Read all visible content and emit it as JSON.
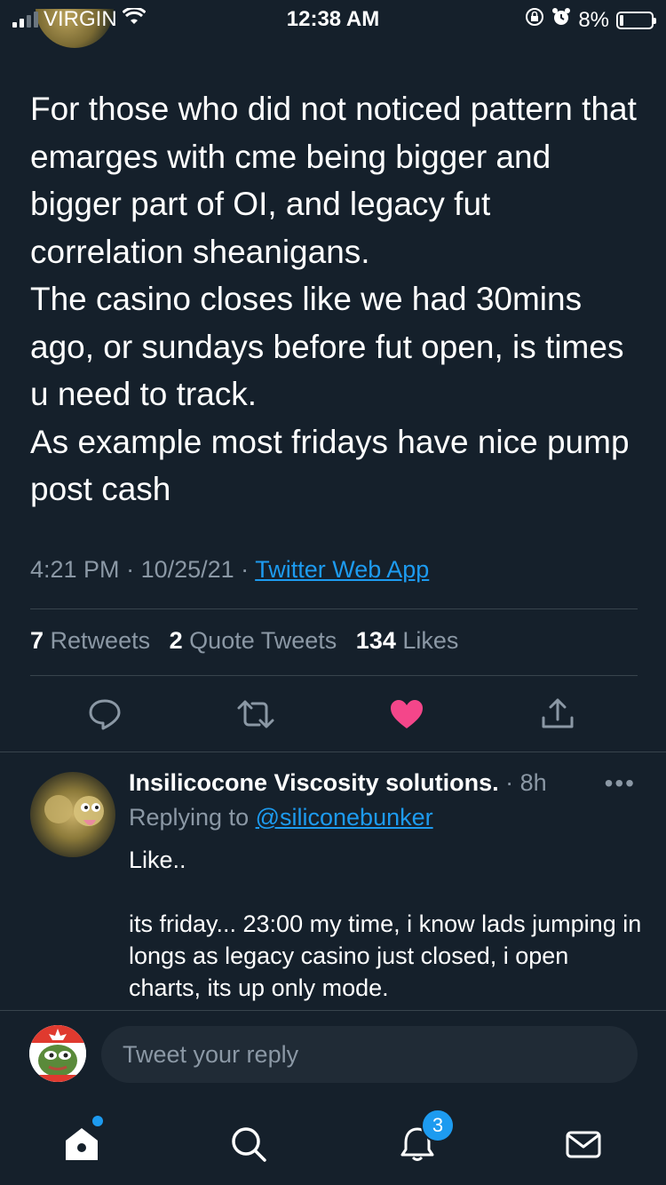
{
  "status_bar": {
    "carrier": "VIRGIN",
    "time": "12:38 AM",
    "battery": "8%"
  },
  "tweet": {
    "text": "For those who did not noticed pattern that emarges with cme being bigger and bigger part of OI, and legacy fut correlation sheanigans.\nThe casino closes like we had 30mins ago, or sundays before fut open, is times u need to track.\nAs example most fridays have nice pump post cash",
    "time": "4:21 PM",
    "date": "10/25/21",
    "sep": " · ",
    "source": "Twitter Web App",
    "retweets_count": "7",
    "retweets_label": "Retweets",
    "quotes_count": "2",
    "quotes_label": "Quote Tweets",
    "likes_count": "134",
    "likes_label": "Likes",
    "liked": true,
    "like_color": "#f4468a"
  },
  "reply": {
    "name": "Insilicocone Viscosity solutions.",
    "time": " · 8h",
    "replying_label": "Replying to",
    "replying_handle": "@siliconebunker",
    "text": "Like..\n\nits friday... 23:00 my time, i know lads jumping in longs as legacy casino just closed, i open charts, its up only mode.",
    "more": "•••"
  },
  "compose": {
    "placeholder": "Tweet your reply"
  },
  "tabbar": {
    "notifications_badge": "3",
    "items": [
      "home-icon",
      "search-icon",
      "bell-icon",
      "mail-icon"
    ]
  },
  "colors": {
    "background": "#15202b",
    "accent": "#1d9bf0",
    "muted": "#8b98a5"
  }
}
